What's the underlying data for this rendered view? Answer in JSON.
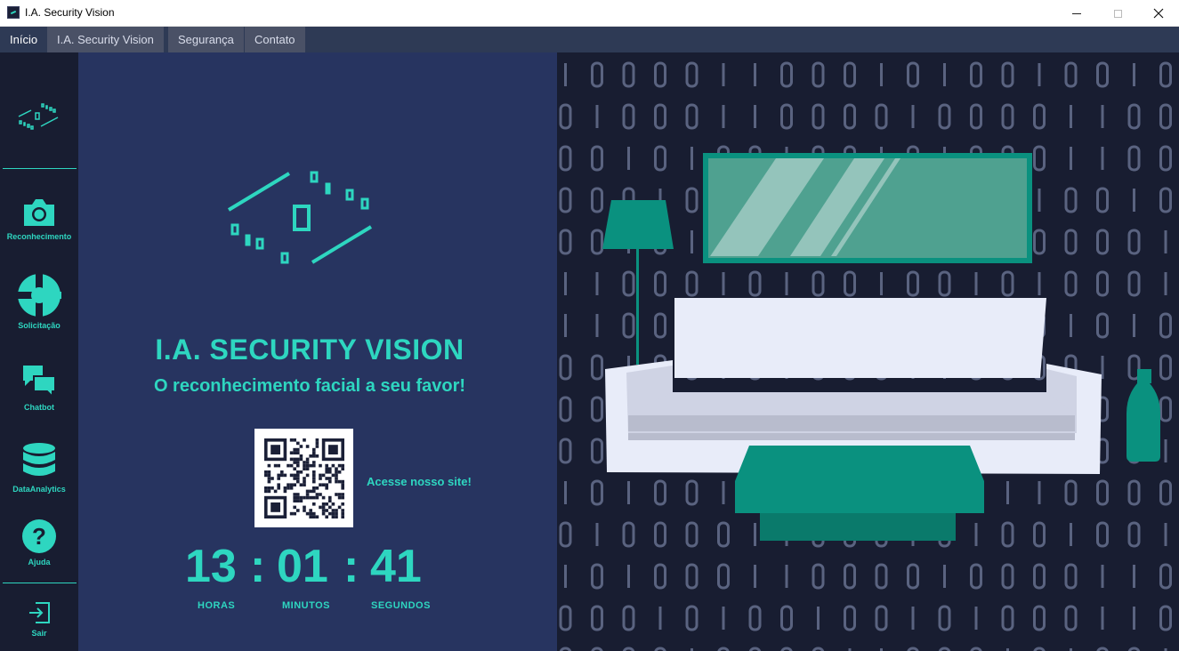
{
  "window": {
    "title": "I.A. Security Vision",
    "controls": {
      "minimize": "—",
      "maximize": "☐",
      "close": "✕"
    }
  },
  "menu": {
    "items": [
      {
        "label": "Início",
        "active": true
      },
      {
        "label": "I.A. Security Vision",
        "active": false
      },
      {
        "label": "Segurança",
        "active": false
      },
      {
        "label": "Contato",
        "active": false
      }
    ]
  },
  "sidebar": {
    "items": [
      {
        "label": "Reconhecimento",
        "icon": "camera-icon"
      },
      {
        "label": "Solicitação",
        "icon": "request-pie-icon"
      },
      {
        "label": "Chatbot",
        "icon": "chat-bubbles-icon"
      },
      {
        "label": "DataAnalytics",
        "icon": "database-icon"
      },
      {
        "label": "Ajuda",
        "icon": "help-icon"
      },
      {
        "label": "Sair",
        "icon": "exit-icon"
      }
    ]
  },
  "main": {
    "title": "I.A. SECURITY VISION",
    "subtitle": "O reconhecimento facial a seu favor!",
    "qr_label": "Acesse nosso site!",
    "clock": {
      "hours": "13",
      "minutes": "01",
      "seconds": "41",
      "separator": ":",
      "hours_label": "HORAS",
      "minutes_label": "MINUTOS",
      "seconds_label": "SEGUNDOS"
    }
  },
  "colors": {
    "accent": "#2ed6c0",
    "panel": "#273460",
    "dark": "#181d31",
    "teal": "#0a917f",
    "sofa": "#e8ecf9"
  }
}
